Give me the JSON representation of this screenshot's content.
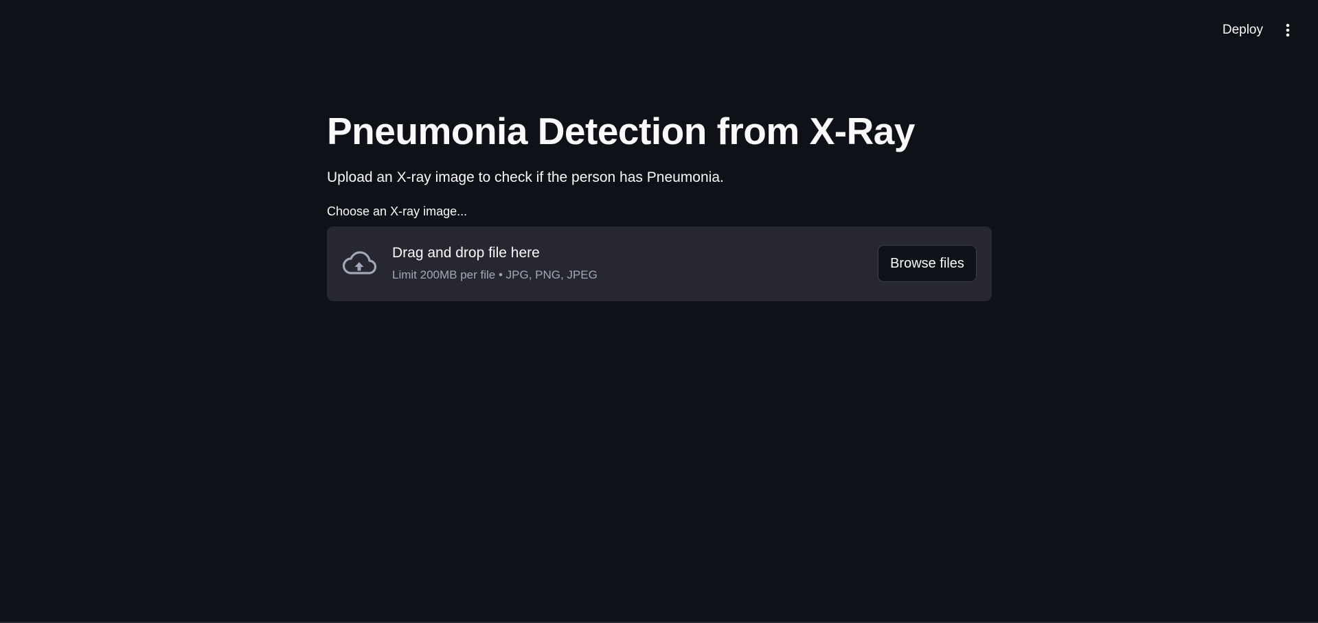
{
  "header": {
    "deploy_label": "Deploy",
    "menu_icon": "vertical-ellipsis-icon"
  },
  "main": {
    "title": "Pneumonia Detection from X-Ray",
    "subtitle": "Upload an X-ray image to check if the person has Pneumonia.",
    "uploader": {
      "label": "Choose an X-ray image...",
      "icon": "cloud-upload-icon",
      "dropzone_title": "Drag and drop file here",
      "dropzone_limit": "Limit 200MB per file • JPG, PNG, JPEG",
      "browse_label": "Browse files"
    }
  },
  "colors": {
    "background": "#0e1117",
    "dropzone_background": "#262730",
    "text": "#fafafa",
    "muted_text": "#a3a8b8"
  }
}
